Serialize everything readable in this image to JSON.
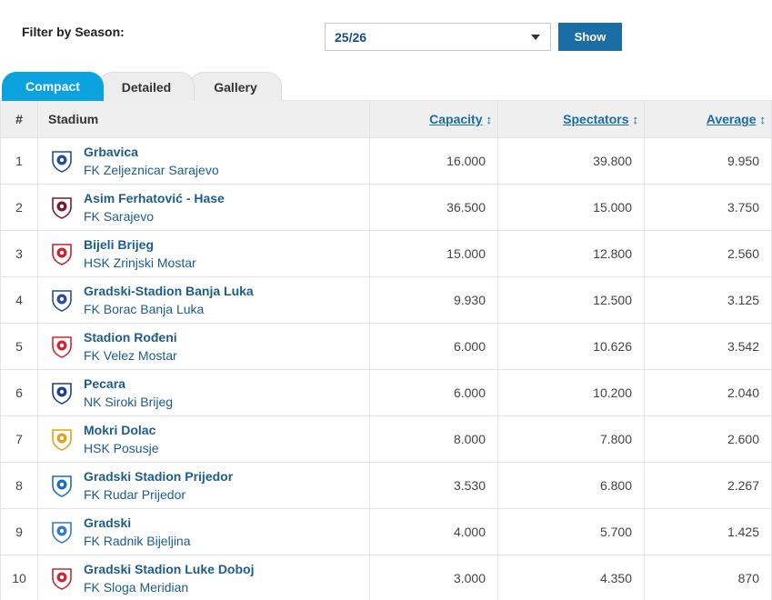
{
  "filter": {
    "label": "Filter by Season:",
    "selected": "25/26",
    "button": "Show"
  },
  "tabs": [
    {
      "label": "Compact"
    },
    {
      "label": "Detailed"
    },
    {
      "label": "Gallery"
    }
  ],
  "table": {
    "headers": {
      "num": "#",
      "stadium": "Stadium",
      "capacity": "Capacity",
      "spectators": "Spectators",
      "average": "Average"
    },
    "sort_glyph": "↕",
    "rows": [
      {
        "rank": "1",
        "stadium": "Grbavica",
        "club": "FK Zeljeznicar Sarajevo",
        "capacity": "16.000",
        "spectators": "39.800",
        "average": "9.950",
        "crest": "zeljeznicar-crest-icon",
        "color": "#1f4e9a"
      },
      {
        "rank": "2",
        "stadium": "Asim Ferhatović - Hase",
        "club": "FK Sarajevo",
        "capacity": "36.500",
        "spectators": "15.000",
        "average": "3.750",
        "crest": "sarajevo-crest-icon",
        "color": "#7a1b2e"
      },
      {
        "rank": "3",
        "stadium": "Bijeli Brijeg",
        "club": "HSK Zrinjski Mostar",
        "capacity": "15.000",
        "spectators": "12.800",
        "average": "2.560",
        "crest": "zrinjski-crest-icon",
        "color": "#c8232c"
      },
      {
        "rank": "4",
        "stadium": "Gradski-Stadion Banja Luka",
        "club": "FK Borac Banja Luka",
        "capacity": "9.930",
        "spectators": "12.500",
        "average": "3.125",
        "crest": "borac-crest-icon",
        "color": "#2b4c9a"
      },
      {
        "rank": "5",
        "stadium": "Stadion Rođeni",
        "club": "FK Velez Mostar",
        "capacity": "6.000",
        "spectators": "10.626",
        "average": "3.542",
        "crest": "velez-crest-icon",
        "color": "#d22630"
      },
      {
        "rank": "6",
        "stadium": "Pecara",
        "club": "NK Siroki Brijeg",
        "capacity": "6.000",
        "spectators": "10.200",
        "average": "2.040",
        "crest": "siroki-brijeg-crest-icon",
        "color": "#1c3f8f"
      },
      {
        "rank": "7",
        "stadium": "Mokri Dolac",
        "club": "HSK Posusje",
        "capacity": "8.000",
        "spectators": "7.800",
        "average": "2.600",
        "crest": "posusje-crest-icon",
        "color": "#e2a21b"
      },
      {
        "rank": "8",
        "stadium": "Gradski Stadion Prijedor",
        "club": "FK Rudar Prijedor",
        "capacity": "3.530",
        "spectators": "6.800",
        "average": "2.267",
        "crest": "rudar-crest-icon",
        "color": "#1a6fc0"
      },
      {
        "rank": "9",
        "stadium": "Gradski",
        "club": "FK Radnik Bijeljina",
        "capacity": "4.000",
        "spectators": "5.700",
        "average": "1.425",
        "crest": "radnik-crest-icon",
        "color": "#3a78c8"
      },
      {
        "rank": "10",
        "stadium": "Gradski Stadion Luke Doboj",
        "club": "FK Sloga Meridian",
        "capacity": "3.000",
        "spectators": "4.350",
        "average": "870",
        "crest": "sloga-crest-icon",
        "color": "#c62a3a"
      }
    ]
  }
}
